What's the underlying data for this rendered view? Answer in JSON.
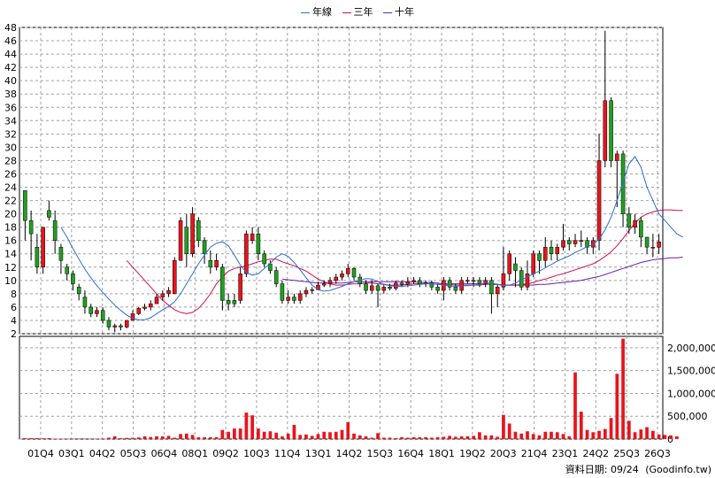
{
  "legend": {
    "items": [
      {
        "label": "年線",
        "color": "#2a6fd6"
      },
      {
        "label": "三年",
        "color": "#d01050"
      },
      {
        "label": "十年",
        "color": "#6a1fb0"
      }
    ]
  },
  "footer": {
    "date_text": "資料日期: 09/24",
    "source_text": "(Goodinfo.tw)"
  },
  "chart_data": {
    "type": "candlestick",
    "title": "",
    "price_axis": {
      "min": 2,
      "max": 48,
      "ticks": [
        2,
        4,
        6,
        8,
        10,
        12,
        14,
        16,
        18,
        20,
        22,
        24,
        26,
        28,
        30,
        32,
        34,
        36,
        38,
        40,
        42,
        44,
        46,
        48
      ]
    },
    "volume_axis": {
      "min": 0,
      "max": 2250000,
      "ticks": [
        0,
        500000,
        1000000,
        1500000,
        2000000
      ],
      "tick_labels": [
        "0",
        "500,000",
        "1,000,000",
        "1,500,000",
        "2,000,000"
      ]
    },
    "x_tick_labels": [
      "01Q4",
      "03Q1",
      "04Q2",
      "05Q3",
      "06Q4",
      "08Q1",
      "09Q2",
      "10Q3",
      "11Q4",
      "13Q1",
      "14Q2",
      "15Q3",
      "16Q4",
      "18Q1",
      "19Q2",
      "20Q3",
      "21Q4",
      "23Q1",
      "24Q2",
      "25Q3",
      "26Q3"
    ],
    "grid": true,
    "colors": {
      "up": "#e8141c",
      "down": "#20a020",
      "volume": "#e8141c",
      "annual_ma": "#2a6fd6",
      "three_year_ma": "#d01050",
      "ten_year_ma": "#6a1fb0"
    },
    "candles": [
      [
        23.5,
        19,
        23.5,
        16
      ],
      [
        19,
        17,
        20.5,
        13
      ],
      [
        15,
        12,
        17,
        11
      ],
      [
        12,
        18,
        18,
        11
      ],
      [
        20.5,
        19.5,
        22,
        19
      ],
      [
        19,
        16,
        20.5,
        14
      ],
      [
        15,
        13,
        15.5,
        11
      ],
      [
        12,
        11,
        12.5,
        10
      ],
      [
        11,
        9.5,
        11.5,
        8.5
      ],
      [
        9,
        8,
        9.5,
        7
      ],
      [
        7.5,
        6,
        8.5,
        5
      ],
      [
        6,
        5,
        6.5,
        4.5
      ],
      [
        5,
        5.5,
        6,
        4.5
      ],
      [
        5.5,
        4,
        6,
        3.5
      ],
      [
        4,
        3,
        4.5,
        2.5
      ],
      [
        3,
        3.2,
        3.5,
        2.2
      ],
      [
        3.2,
        3,
        3.5,
        2.5
      ],
      [
        3,
        4,
        4,
        2.8
      ],
      [
        4,
        5,
        5.5,
        4
      ],
      [
        5,
        5.8,
        6,
        4.8
      ],
      [
        5.8,
        6,
        6.5,
        5.5
      ],
      [
        6,
        6.5,
        7,
        5.5
      ],
      [
        6.5,
        7.5,
        8,
        6.5
      ],
      [
        7.5,
        8,
        8.5,
        7
      ],
      [
        8,
        8.5,
        9,
        7.5
      ],
      [
        8,
        13,
        13.5,
        8
      ],
      [
        13,
        19,
        19.5,
        13
      ],
      [
        18,
        14,
        20,
        12
      ],
      [
        14,
        20,
        21,
        13.5
      ],
      [
        19,
        16,
        19.5,
        15
      ],
      [
        16,
        14,
        16.5,
        12.5
      ],
      [
        13,
        12,
        14.5,
        11
      ],
      [
        12,
        13,
        14,
        11.5
      ],
      [
        12,
        7,
        12.5,
        5.5
      ],
      [
        7,
        6.5,
        8,
        5.5
      ],
      [
        7,
        6.5,
        8,
        6
      ],
      [
        7,
        11,
        12,
        6.5
      ],
      [
        11,
        17,
        17.5,
        10.5
      ],
      [
        16,
        17,
        18,
        15.5
      ],
      [
        17,
        14,
        18,
        13
      ],
      [
        14,
        12.5,
        14.5,
        12
      ],
      [
        12.5,
        11.5,
        13,
        11
      ],
      [
        11.5,
        9.5,
        12,
        9
      ],
      [
        9.5,
        7,
        10,
        6.5
      ],
      [
        7,
        7.5,
        8.5,
        6.5
      ],
      [
        7.5,
        7,
        8,
        6.5
      ],
      [
        7,
        8,
        8.5,
        6.5
      ],
      [
        8,
        8.5,
        9,
        7.5
      ],
      [
        8.5,
        8.6,
        9,
        8
      ],
      [
        8.6,
        9.3,
        9.8,
        8.5
      ],
      [
        9.3,
        9.5,
        10,
        9
      ],
      [
        9.5,
        10,
        10.5,
        9
      ],
      [
        10,
        10.5,
        11,
        9.5
      ],
      [
        10.5,
        11,
        11.5,
        10
      ],
      [
        11,
        11.8,
        12.5,
        10.5
      ],
      [
        11.8,
        10.5,
        12,
        10
      ],
      [
        10.5,
        9.5,
        11,
        9
      ],
      [
        9.5,
        8.5,
        10,
        8
      ],
      [
        8.5,
        9.2,
        10,
        8
      ],
      [
        9.2,
        8.5,
        9.5,
        6
      ],
      [
        8.5,
        9,
        9.5,
        8
      ],
      [
        9,
        8.8,
        9.5,
        8.5
      ],
      [
        8.8,
        9.6,
        10,
        8.5
      ],
      [
        9.6,
        9.4,
        10,
        9
      ],
      [
        9.4,
        9.8,
        10.5,
        9
      ],
      [
        9.8,
        10,
        10.5,
        9.5
      ],
      [
        10,
        9.5,
        10.5,
        9
      ],
      [
        9.5,
        9.6,
        10,
        9
      ],
      [
        9.6,
        9,
        10,
        8.5
      ],
      [
        9,
        8.5,
        9.5,
        8
      ],
      [
        8.5,
        10,
        10.5,
        7
      ],
      [
        10,
        9,
        10.5,
        8.5
      ],
      [
        9,
        8.5,
        9.5,
        8
      ],
      [
        8.5,
        10,
        10.5,
        8
      ],
      [
        10,
        10,
        10.5,
        9.5
      ],
      [
        10,
        10,
        10.5,
        9
      ],
      [
        10,
        9.5,
        10.5,
        9
      ],
      [
        9.5,
        10,
        10.5,
        9
      ],
      [
        10,
        8,
        10.5,
        5
      ],
      [
        8,
        9,
        9.5,
        6
      ],
      [
        9,
        11,
        15,
        8.5
      ],
      [
        11,
        14,
        14.5,
        10
      ],
      [
        12.5,
        11.5,
        13.5,
        9
      ],
      [
        11.5,
        9,
        12,
        8.5
      ],
      [
        9,
        11,
        13,
        8.5
      ],
      [
        11,
        14,
        14.5,
        10.5
      ],
      [
        14,
        13,
        14.5,
        11
      ],
      [
        13,
        15,
        16.5,
        12
      ],
      [
        15,
        14,
        16,
        13
      ],
      [
        14,
        15,
        15.5,
        13
      ],
      [
        15,
        16,
        18.5,
        14.5
      ],
      [
        16,
        15.5,
        16.5,
        14.5
      ],
      [
        15.5,
        16,
        17,
        15
      ],
      [
        16,
        16,
        17.5,
        15
      ],
      [
        16,
        15,
        16.5,
        14
      ],
      [
        15,
        16,
        16.5,
        14
      ],
      [
        16,
        28,
        32,
        14.5
      ],
      [
        28,
        37,
        47.5,
        27
      ],
      [
        37,
        28,
        37.5,
        27
      ],
      [
        28,
        29,
        29.5,
        21
      ],
      [
        29,
        20,
        29.5,
        18
      ],
      [
        20,
        18,
        21,
        17
      ],
      [
        18,
        19,
        20,
        17
      ],
      [
        19,
        16.5,
        19.5,
        15
      ],
      [
        16.5,
        15,
        16.5,
        14
      ],
      [
        15,
        15,
        17,
        13.5
      ],
      [
        15,
        15.8,
        17,
        14
      ]
    ],
    "volume": [
      20000,
      20000,
      20000,
      15000,
      20000,
      10000,
      8000,
      6000,
      6000,
      10000,
      10000,
      10000,
      10000,
      10000,
      30000,
      60000,
      20000,
      25000,
      25000,
      35000,
      60000,
      45000,
      60000,
      60000,
      70000,
      30000,
      110000,
      120000,
      90000,
      40000,
      40000,
      40000,
      40000,
      200000,
      160000,
      230000,
      230000,
      580000,
      520000,
      230000,
      160000,
      170000,
      140000,
      60000,
      120000,
      310000,
      90000,
      100000,
      70000,
      110000,
      160000,
      150000,
      160000,
      200000,
      370000,
      120000,
      80000,
      60000,
      30000,
      130000,
      30000,
      30000,
      20000,
      40000,
      30000,
      40000,
      40000,
      40000,
      30000,
      40000,
      50000,
      70000,
      50000,
      60000,
      60000,
      70000,
      150000,
      80000,
      80000,
      50000,
      530000,
      340000,
      160000,
      120000,
      170000,
      110000,
      80000,
      160000,
      160000,
      150000,
      110000,
      60000,
      1460000,
      600000,
      200000,
      150000,
      180000,
      220000,
      460000,
      1430000,
      2200000,
      400000,
      150000,
      210000,
      260000,
      180000,
      100000,
      90000,
      80000,
      60000
    ],
    "annual_ma": [
      null,
      null,
      null,
      null,
      null,
      null,
      18,
      16.5,
      14.8,
      13.2,
      11.7,
      10.4,
      9.2,
      8.2,
      7.2,
      6.3,
      5.5,
      4.8,
      4.3,
      4.1,
      4.1,
      4.4,
      5,
      5.6,
      6.1,
      6.8,
      8,
      9.5,
      11,
      12.5,
      13.8,
      15,
      15.6,
      15.8,
      15.2,
      13.8,
      12.3,
      11.2,
      10.8,
      11,
      11.8,
      12.6,
      13.5,
      14,
      13.6,
      12.7,
      11.6,
      10.4,
      9.3,
      8.6,
      8.4,
      8.5,
      8.8,
      9.1,
      9.5,
      9.8,
      10,
      10.3,
      10.2,
      9.8,
      9.4,
      9.2,
      9.1,
      9.1,
      9.2,
      9.3,
      9.4,
      9.5,
      9.5,
      9.4,
      9.3,
      9.2,
      9.1,
      9.2,
      9.2,
      9.3,
      9.4,
      9.6,
      9.6,
      9.4,
      9.2,
      9.3,
      9.6,
      10.1,
      10.5,
      11,
      11.4,
      11.9,
      12.4,
      12.9,
      13.3,
      13.7,
      14.2,
      14.6,
      15.1,
      15.4,
      16.2,
      17.6,
      19.5,
      22,
      24.8,
      27.5,
      28.6,
      27,
      24,
      22,
      20,
      19,
      18,
      17,
      16.5
    ],
    "three_year_ma": [
      null,
      null,
      null,
      null,
      null,
      null,
      null,
      null,
      null,
      null,
      null,
      null,
      null,
      null,
      null,
      null,
      null,
      13,
      12,
      11,
      10,
      9,
      8,
      7,
      6.3,
      5.6,
      5.2,
      5,
      5.2,
      5.8,
      6.8,
      8,
      9.5,
      10.5,
      11.4,
      11.8,
      12,
      12.2,
      12.5,
      12.8,
      13,
      13.2,
      13.2,
      12.8,
      12.5,
      12.2,
      11.8,
      11.4,
      10.8,
      10.2,
      9.8,
      9.5,
      9.3,
      9.3,
      9.4,
      9.5,
      9.5,
      9.6,
      9.6,
      9.5,
      9.4,
      9.3,
      9.3,
      9.3,
      9.4,
      9.5,
      9.5,
      9.5,
      9.5,
      9.4,
      9.4,
      9.4,
      9.3,
      9.3,
      9.3,
      9.3,
      9.3,
      9.4,
      9.4,
      9.4,
      9.3,
      9.3,
      9.3,
      9.4,
      9.5,
      9.7,
      10,
      10.2,
      10.5,
      10.8,
      11,
      11.3,
      11.6,
      11.9,
      12.2,
      12.5,
      13,
      13.6,
      14.3,
      15.2,
      16.3,
      17.5,
      18.6,
      19.5,
      20,
      20.3,
      20.5,
      20.6,
      20.6,
      20.5,
      20.5
    ],
    "ten_year_ma": [
      null,
      null,
      null,
      null,
      null,
      null,
      null,
      null,
      null,
      null,
      null,
      null,
      null,
      null,
      null,
      null,
      null,
      null,
      null,
      null,
      null,
      null,
      null,
      null,
      null,
      null,
      null,
      null,
      null,
      null,
      null,
      null,
      null,
      null,
      null,
      null,
      null,
      null,
      null,
      null,
      null,
      null,
      null,
      10.2,
      10.1,
      10,
      9.9,
      9.8,
      9.7,
      9.6,
      9.6,
      9.6,
      9.6,
      9.6,
      9.7,
      9.8,
      9.8,
      9.8,
      9.8,
      9.8,
      9.8,
      9.8,
      9.8,
      9.8,
      9.8,
      9.8,
      9.7,
      9.7,
      9.7,
      9.6,
      9.5,
      9.5,
      9.5,
      9.5,
      9.5,
      9.5,
      9.5,
      9.5,
      9.4,
      9.4,
      9.3,
      9.3,
      9.3,
      9.3,
      9.3,
      9.3,
      9.4,
      9.4,
      9.5,
      9.6,
      9.7,
      9.8,
      9.9,
      10,
      10.2,
      10.4,
      10.6,
      10.9,
      11.2,
      11.5,
      11.8,
      12.1,
      12.4,
      12.7,
      12.9,
      13.1,
      13.2,
      13.3,
      13.4,
      13.4,
      13.5
    ]
  }
}
